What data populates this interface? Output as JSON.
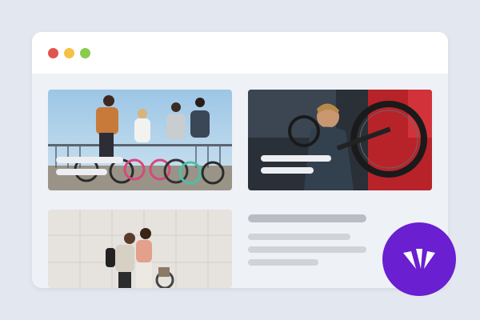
{
  "colors": {
    "page_background": "#e3e7ef",
    "window_background": "#eef1f6",
    "titlebar_background": "#ffffff",
    "traffic_close": "#e0544f",
    "traffic_minimize": "#f5c244",
    "traffic_maximize": "#8ccb4e",
    "placeholder_light": "#eceef2",
    "placeholder_title": "#b9bcc2",
    "placeholder_text": "#d0d3d8",
    "brand": "#6a1fd1"
  },
  "window": {
    "controls": [
      "close",
      "minimize",
      "maximize"
    ]
  },
  "cards": [
    {
      "image": "group-cycling-photo",
      "caption_lines": 2
    },
    {
      "image": "bike-mechanic-photo",
      "caption_lines": 2
    },
    {
      "image": "couple-with-bike-photo",
      "caption_lines": 0
    }
  ],
  "article": {
    "title_lines": 1,
    "text_lines": 3
  },
  "brand_badge": {
    "icon": "brand-logo-icon"
  }
}
